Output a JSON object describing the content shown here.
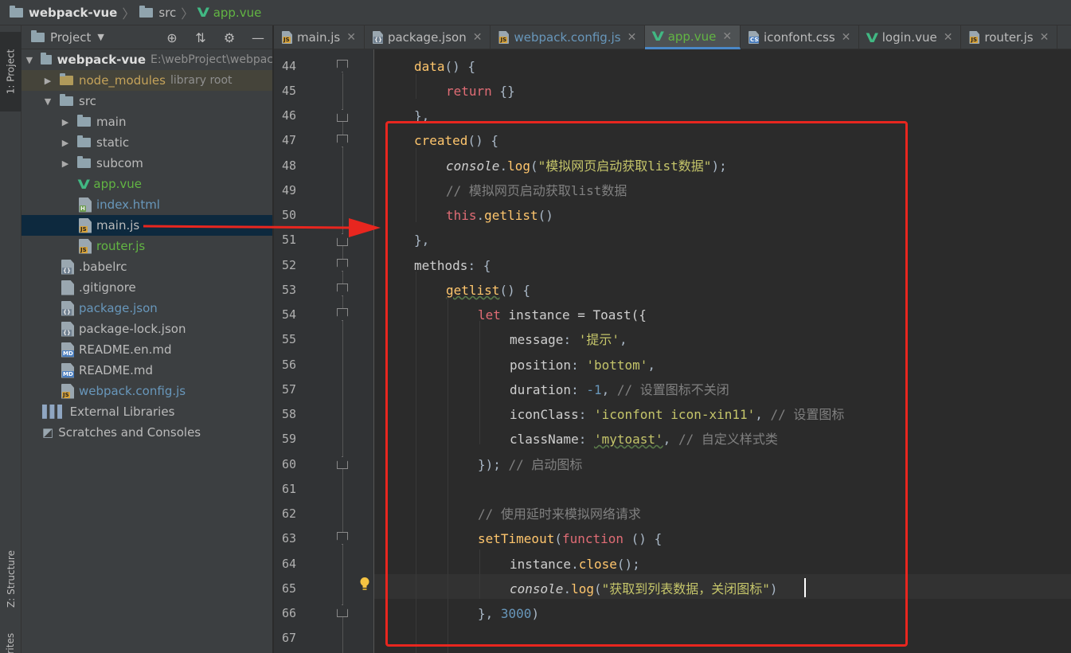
{
  "breadcrumb": {
    "project": "webpack-vue",
    "folder": "src",
    "file": "app.vue"
  },
  "side_tabs": {
    "project": "1: Project",
    "structure": "Z: Structure",
    "favorites": "Favorites"
  },
  "panel": {
    "title": "Project",
    "root": {
      "name": "webpack-vue",
      "path": "E:\\webProject\\webpac"
    },
    "items": [
      {
        "name": "node_modules",
        "note": "library root"
      },
      {
        "name": "src"
      },
      {
        "name": "main"
      },
      {
        "name": "static"
      },
      {
        "name": "subcom"
      },
      {
        "name": "app.vue"
      },
      {
        "name": "index.html"
      },
      {
        "name": "main.js"
      },
      {
        "name": "router.js"
      },
      {
        "name": ".babelrc"
      },
      {
        "name": ".gitignore"
      },
      {
        "name": "package.json"
      },
      {
        "name": "package-lock.json"
      },
      {
        "name": "README.en.md"
      },
      {
        "name": "README.md"
      },
      {
        "name": "webpack.config.js"
      },
      {
        "name": "External Libraries"
      },
      {
        "name": "Scratches and Consoles"
      }
    ]
  },
  "tabs": [
    {
      "label": "main.js"
    },
    {
      "label": "package.json"
    },
    {
      "label": "webpack.config.js"
    },
    {
      "label": "app.vue"
    },
    {
      "label": "iconfont.css"
    },
    {
      "label": "login.vue"
    },
    {
      "label": "router.js"
    }
  ],
  "file_badges": {
    "js": "JS",
    "json": "{}",
    "html": "H",
    "md": "MD",
    "css": "CSS"
  },
  "line_numbers": [
    "44",
    "45",
    "46",
    "47",
    "48",
    "49",
    "50",
    "51",
    "52",
    "53",
    "54",
    "55",
    "56",
    "57",
    "58",
    "59",
    "60",
    "61",
    "62",
    "63",
    "64",
    "65",
    "66",
    "67"
  ],
  "code": {
    "l44": [
      "data",
      "() {"
    ],
    "l45": [
      "return",
      " {}"
    ],
    "l46": [
      "},"
    ],
    "l47": [
      "created",
      "() {"
    ],
    "l48": [
      "console",
      ".",
      "log",
      "(",
      "\"模拟网页启动获取list数据\"",
      ");"
    ],
    "l49": [
      "// 模拟网页启动获取list数据"
    ],
    "l50": [
      "this",
      ".",
      "getlist",
      "()"
    ],
    "l51": [
      "},"
    ],
    "l52": [
      "methods",
      ": {"
    ],
    "l53": [
      "getlist",
      "() {"
    ],
    "l54": [
      "let",
      " instance = Toast({"
    ],
    "l55": [
      "message",
      ": ",
      "'提示'",
      ","
    ],
    "l56": [
      "position",
      ": ",
      "'bottom'",
      ","
    ],
    "l57": [
      "duration",
      ": ",
      "-1",
      ", ",
      "// 设置图标不关闭"
    ],
    "l58": [
      "iconClass",
      ": ",
      "'iconfont icon-xin11'",
      ", ",
      "// 设置图标"
    ],
    "l59": [
      "className",
      ": ",
      "'mytoast'",
      ", ",
      "// 自定义样式类"
    ],
    "l60": [
      "}); ",
      "// 启动图标"
    ],
    "l62": [
      "// 使用延时来模拟网络请求"
    ],
    "l63": [
      "setTimeout",
      "(",
      "function",
      " () {"
    ],
    "l64": [
      "instance",
      ".",
      "close",
      "();"
    ],
    "l65": [
      "console",
      ".",
      "log",
      "(",
      "\"获取到列表数据，关闭图标\"",
      ")"
    ],
    "l66": [
      "}, ",
      "3000",
      ")"
    ]
  }
}
